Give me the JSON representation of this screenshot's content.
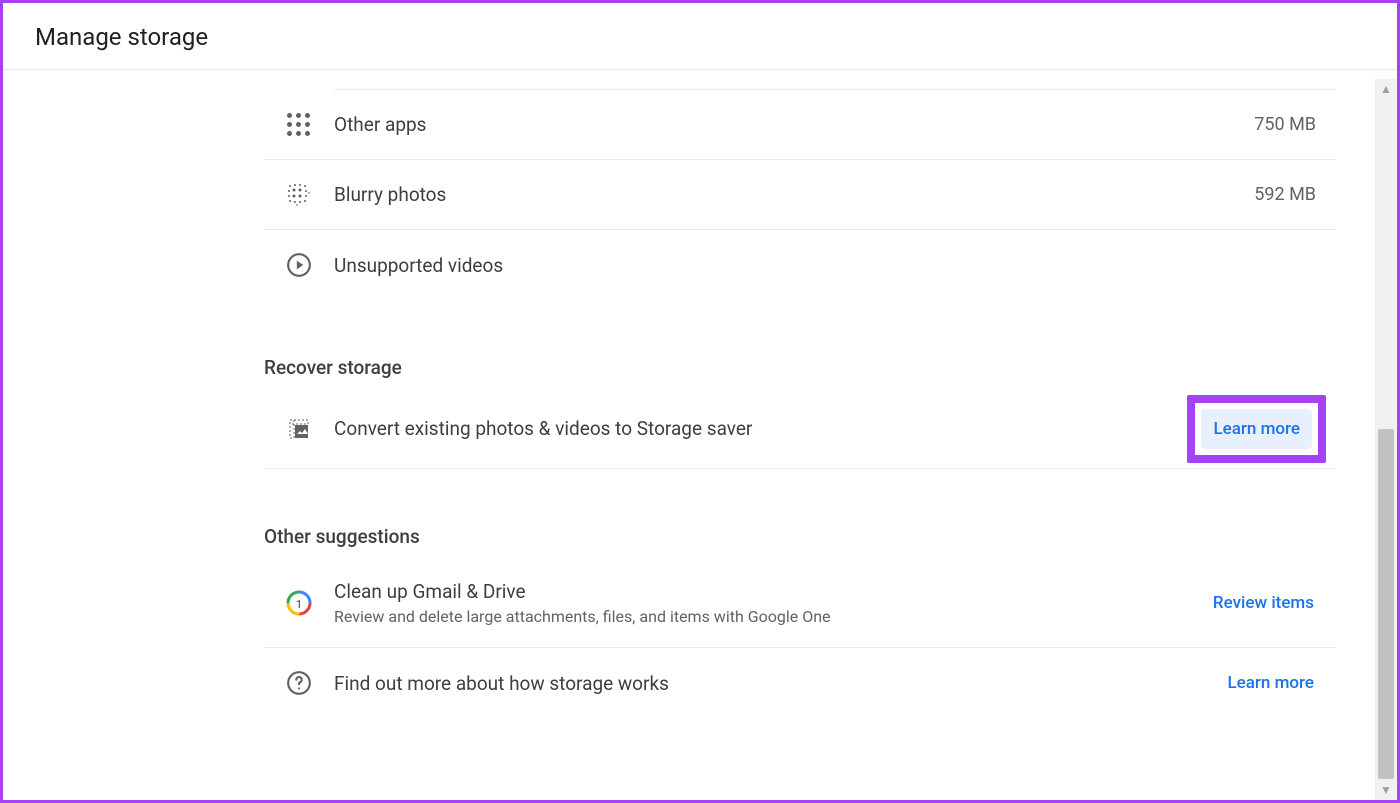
{
  "header": {
    "title": "Manage storage"
  },
  "storage_items": [
    {
      "label": "Other apps",
      "value": "750 MB"
    },
    {
      "label": "Blurry photos",
      "value": "592 MB"
    },
    {
      "label": "Unsupported videos",
      "value": ""
    }
  ],
  "recover": {
    "title": "Recover storage",
    "item_label": "Convert existing photos & videos to Storage saver",
    "action": "Learn more"
  },
  "suggestions": {
    "title": "Other suggestions",
    "items": [
      {
        "label": "Clean up Gmail & Drive",
        "sub": "Review and delete large attachments, files, and items with Google One",
        "action": "Review items"
      },
      {
        "label": "Find out more about how storage works",
        "sub": "",
        "action": "Learn more"
      }
    ]
  }
}
